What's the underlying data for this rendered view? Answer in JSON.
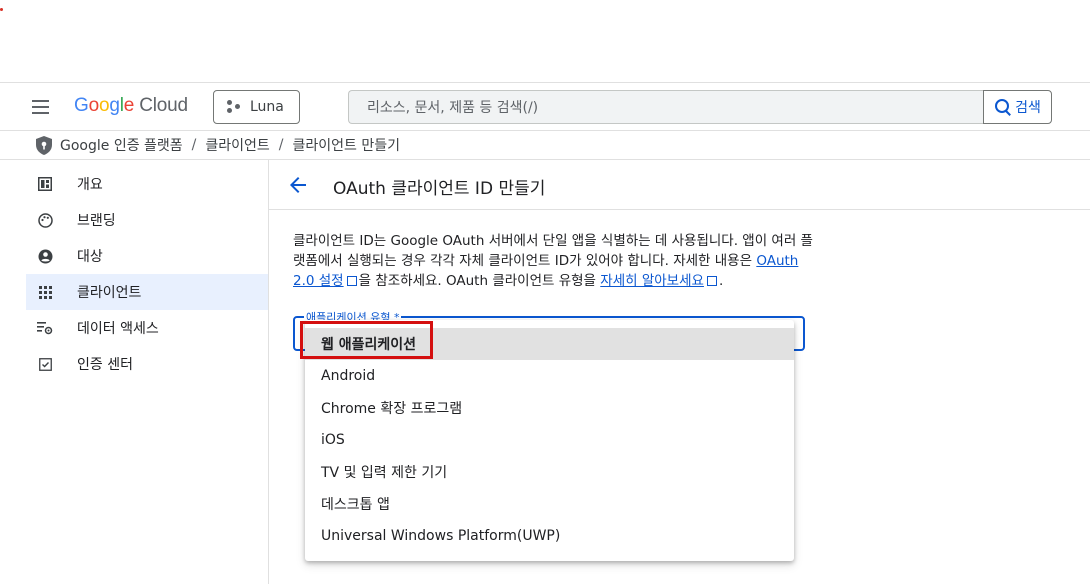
{
  "header": {
    "logo_google": "Google",
    "logo_cloud": "Cloud",
    "project_name": "Luna",
    "search_placeholder": "리소스, 문서, 제품 등 검색(/)",
    "search_button": "검색"
  },
  "breadcrumb": {
    "items": [
      "Google 인증 플랫폼",
      "클라이언트",
      "클라이언트 만들기"
    ],
    "separator": "/"
  },
  "sidebar": {
    "items": [
      {
        "label": "개요",
        "icon": "dashboard-icon",
        "active": false
      },
      {
        "label": "브랜딩",
        "icon": "palette-icon",
        "active": false
      },
      {
        "label": "대상",
        "icon": "account-circle-icon",
        "active": false
      },
      {
        "label": "클라이언트",
        "icon": "apps-grid-icon",
        "active": true
      },
      {
        "label": "데이터 액세스",
        "icon": "data-settings-icon",
        "active": false
      },
      {
        "label": "인증 센터",
        "icon": "verified-check-icon",
        "active": false
      }
    ]
  },
  "main": {
    "title": "OAuth 클라이언트 ID 만들기",
    "description": {
      "text1": "클라이언트 ID는 Google OAuth 서버에서 단일 앱을 식별하는 데 사용됩니다. 앱이 여러 플랫폼에서 실행되는 경우 각각 자체 클라이언트 ID가 있어야 합니다. 자세한 내용은",
      "link1": "OAuth 2.0 설정",
      "text2": "을 참조하세요. OAuth 클라이언트 유형을",
      "link2": "자세히 알아보세요",
      "text3": "."
    },
    "select_label": "애플리케이션 유형 *",
    "dropdown_options": [
      {
        "label": "웹 애플리케이션",
        "selected": true
      },
      {
        "label": "Android",
        "selected": false
      },
      {
        "label": "Chrome 확장 프로그램",
        "selected": false
      },
      {
        "label": "iOS",
        "selected": false
      },
      {
        "label": "TV 및 입력 제한 기기",
        "selected": false
      },
      {
        "label": "데스크톱 앱",
        "selected": false
      },
      {
        "label": "Universal Windows Platform(UWP)",
        "selected": false
      }
    ]
  },
  "colors": {
    "accent": "#0b57d0",
    "active_nav_bg": "#e8f0fe",
    "highlight_border": "#d40f0f",
    "selected_option_bg": "#e1e1e1"
  }
}
